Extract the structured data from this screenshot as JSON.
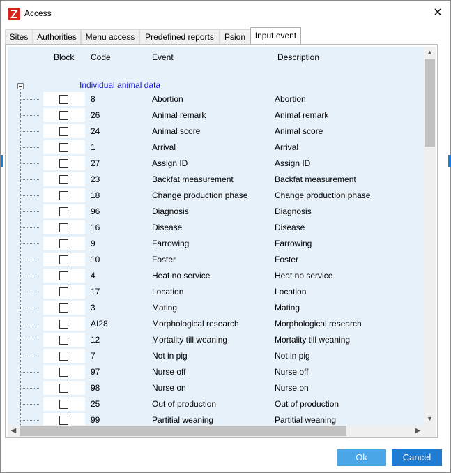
{
  "window": {
    "title": "Access",
    "close_glyph": "✕",
    "brand_color": "#d7261e"
  },
  "tabs": [
    {
      "label": "Sites"
    },
    {
      "label": "Authorities"
    },
    {
      "label": "Menu access"
    },
    {
      "label": "Predefined reports"
    },
    {
      "label": "Psion"
    },
    {
      "label": "Input event",
      "active": true
    }
  ],
  "grid": {
    "headers": {
      "block": "Block",
      "code": "Code",
      "event": "Event",
      "description": "Description"
    },
    "group": "Individual animal data",
    "rows": [
      {
        "code": "8",
        "event": "Abortion",
        "description": "Abortion",
        "blocked": false
      },
      {
        "code": "26",
        "event": "Animal remark",
        "description": "Animal remark",
        "blocked": false
      },
      {
        "code": "24",
        "event": "Animal score",
        "description": "Animal score",
        "blocked": false
      },
      {
        "code": "1",
        "event": "Arrival",
        "description": "Arrival",
        "blocked": false
      },
      {
        "code": "27",
        "event": "Assign ID",
        "description": "Assign ID",
        "blocked": false
      },
      {
        "code": "23",
        "event": "Backfat measurement",
        "description": "Backfat measurement",
        "blocked": false
      },
      {
        "code": "18",
        "event": "Change production phase",
        "description": "Change production phase",
        "blocked": false
      },
      {
        "code": "96",
        "event": "Diagnosis",
        "description": "Diagnosis",
        "blocked": false
      },
      {
        "code": "16",
        "event": "Disease",
        "description": "Disease",
        "blocked": false
      },
      {
        "code": "9",
        "event": "Farrowing",
        "description": "Farrowing",
        "blocked": false
      },
      {
        "code": "10",
        "event": "Foster",
        "description": "Foster",
        "blocked": false
      },
      {
        "code": "4",
        "event": "Heat no service",
        "description": "Heat no service",
        "blocked": false
      },
      {
        "code": "17",
        "event": "Location",
        "description": "Location",
        "blocked": false
      },
      {
        "code": "3",
        "event": "Mating",
        "description": "Mating",
        "blocked": false
      },
      {
        "code": "AI28",
        "event": "Morphological research",
        "description": "Morphological research",
        "blocked": false
      },
      {
        "code": "12",
        "event": "Mortality till weaning",
        "description": "Mortality till weaning",
        "blocked": false
      },
      {
        "code": "7",
        "event": "Not in pig",
        "description": "Not in pig",
        "blocked": false
      },
      {
        "code": "97",
        "event": "Nurse off",
        "description": "Nurse off",
        "blocked": false
      },
      {
        "code": "98",
        "event": "Nurse on",
        "description": "Nurse on",
        "blocked": false
      },
      {
        "code": "25",
        "event": "Out of production",
        "description": "Out of production",
        "blocked": false
      },
      {
        "code": "99",
        "event": "Partitial weaning",
        "description": "Partitial weaning",
        "blocked": false
      }
    ]
  },
  "scroll": {
    "vertical_position": 0.0
  },
  "buttons": {
    "ok": "Ok",
    "cancel": "Cancel"
  },
  "colors": {
    "grid_bg": "#e6f1fa",
    "group_text": "#1a1adc",
    "ok_bg": "#4ba6e8",
    "cancel_bg": "#1f7cd2"
  }
}
